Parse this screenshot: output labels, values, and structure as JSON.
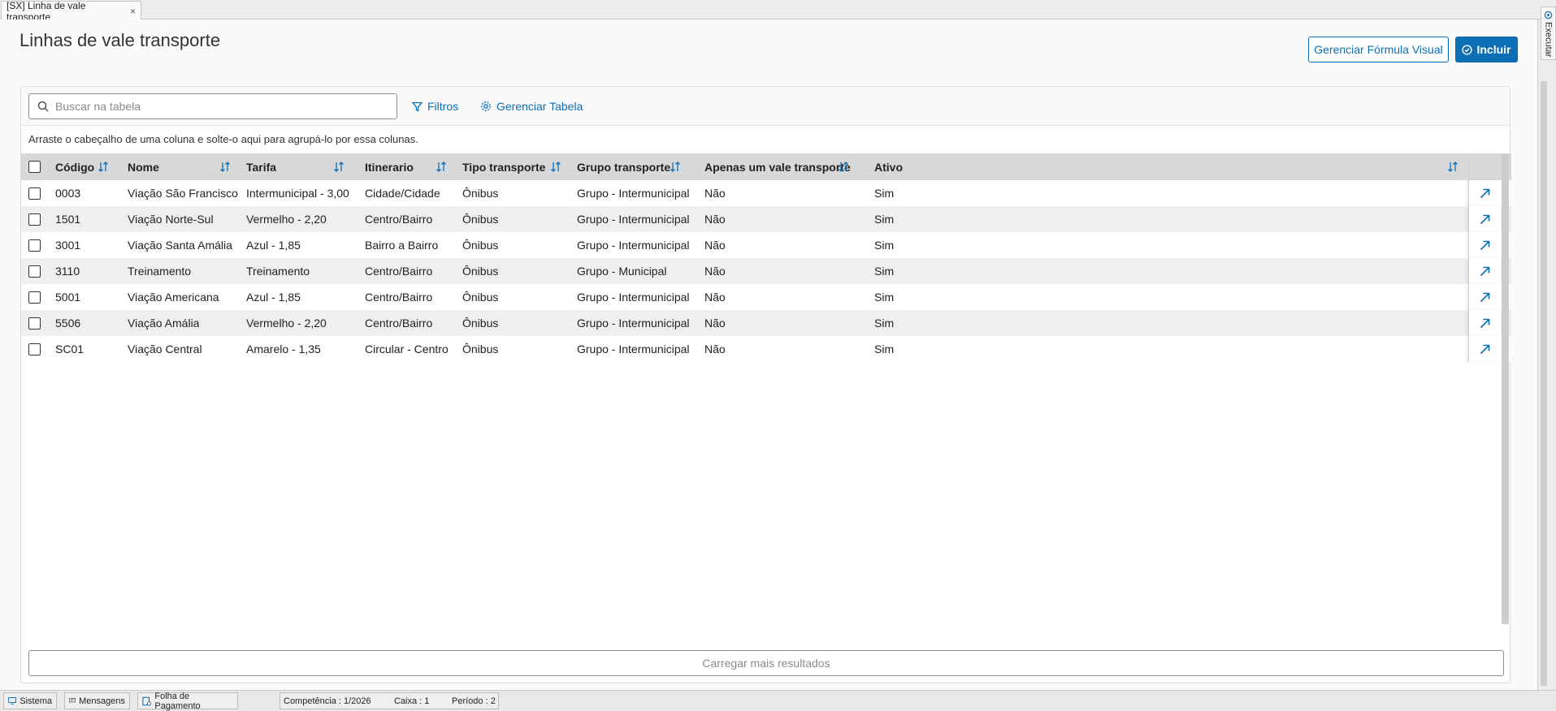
{
  "tab": {
    "title": "[SX] Linha de vale transporte",
    "close": "×"
  },
  "page": {
    "title": "Linhas de vale transporte"
  },
  "actions": {
    "formula_label": "Gerenciar Fórmula Visual",
    "include_label": "Incluir"
  },
  "toolbar": {
    "search_placeholder": "Buscar na tabela",
    "filters_label": "Filtros",
    "manage_table_label": "Gerenciar Tabela"
  },
  "group_hint": "Arraste o cabeçalho de uma coluna e solte-o aqui para agrupá-lo por essa colunas.",
  "table": {
    "columns": [
      "Código",
      "Nome",
      "Tarifa",
      "Itinerario",
      "Tipo transporte",
      "Grupo transporte",
      "Apenas um vale transporte",
      "Ativo"
    ],
    "rows": [
      [
        "0003",
        "Viação São Francisco",
        "Intermunicipal - 3,00",
        "Cidade/Cidade",
        "Ônibus",
        "Grupo - Intermunicipal",
        "Não",
        "Sim"
      ],
      [
        "1501",
        "Viação Norte-Sul",
        "Vermelho - 2,20",
        "Centro/Bairro",
        "Ônibus",
        "Grupo - Intermunicipal",
        "Não",
        "Sim"
      ],
      [
        "3001",
        "Viação Santa Amália",
        "Azul - 1,85",
        "Bairro a Bairro",
        "Ônibus",
        "Grupo - Intermunicipal",
        "Não",
        "Sim"
      ],
      [
        "3110",
        "Treinamento",
        "Treinamento",
        "Centro/Bairro",
        "Ônibus",
        "Grupo - Municipal",
        "Não",
        "Sim"
      ],
      [
        "5001",
        "Viação Americana",
        "Azul - 1,85",
        "Centro/Bairro",
        "Ônibus",
        "Grupo - Intermunicipal",
        "Não",
        "Sim"
      ],
      [
        "5506",
        "Viação Amália",
        "Vermelho - 2,20",
        "Centro/Bairro",
        "Ônibus",
        "Grupo - Intermunicipal",
        "Não",
        "Sim"
      ],
      [
        "SC01",
        "Viação Central",
        "Amarelo - 1,35",
        "Circular - Centro",
        "Ônibus",
        "Grupo - Intermunicipal",
        "Não",
        "Sim"
      ]
    ]
  },
  "load_more": "Carregar mais resultados",
  "side": {
    "execute_label": "Executar"
  },
  "statusbar": {
    "sistema": "Sistema",
    "mensagens": "Mensagens",
    "folha": "Folha de Pagamento",
    "competencia": "Competência : 1/2026",
    "caixa": "Caixa : 1",
    "periodo": "Período : 2"
  },
  "colors": {
    "accent": "#0c6fb5",
    "header_bg": "#d8d8d8",
    "row_alt": "#efefef"
  },
  "icons": [
    "search-icon",
    "filter-icon",
    "gear-icon",
    "sort-icon",
    "open-record-icon",
    "check-circle-icon",
    "gear-run-icon",
    "monitor-icon",
    "message-icon",
    "payroll-icon"
  ]
}
